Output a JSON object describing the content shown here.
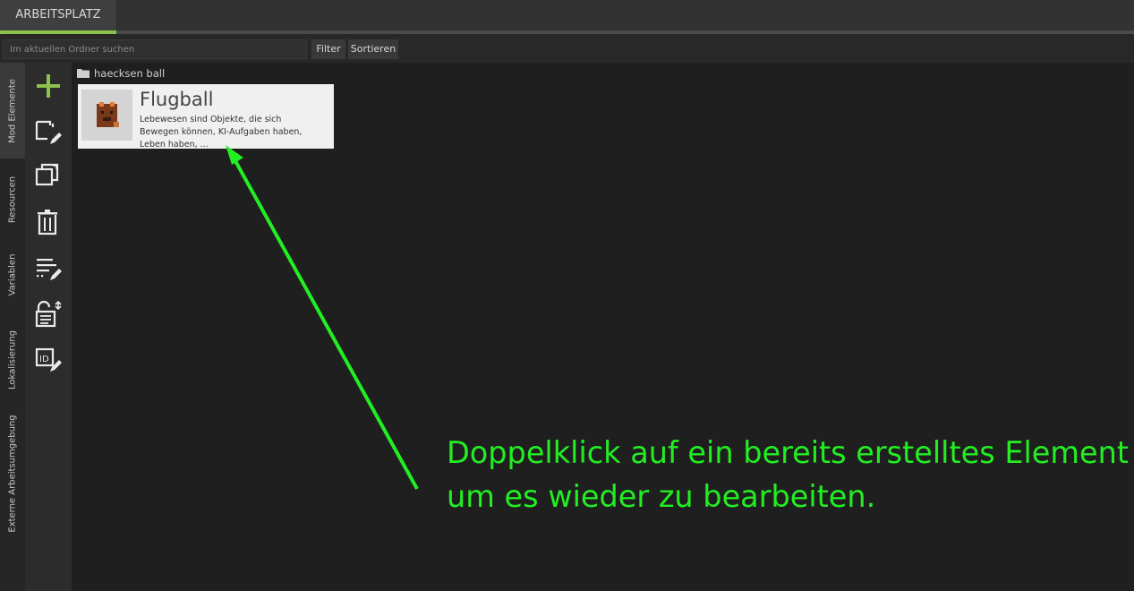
{
  "header": {
    "workspace_tab": "ARBEITSPLATZ"
  },
  "toolbar": {
    "search_placeholder": "Im aktuellen Ordner suchen",
    "filter_label": "Filter",
    "sort_label": "Sortieren"
  },
  "side_tabs": [
    "Mod Elemente",
    "Resourcen",
    "Variablen",
    "Lokalisierung",
    "Externe Arbeitsumgebung"
  ],
  "tool_icons": [
    "add-icon",
    "edit-icon",
    "duplicate-icon",
    "delete-icon",
    "properties-icon",
    "lock-icon",
    "id-icon"
  ],
  "breadcrumb": {
    "folder": "haecksen ball"
  },
  "element_card": {
    "title": "Flugball",
    "description": "Lebewesen sind Objekte, die sich Bewegen können, KI-Aufgaben haben, Leben haben, ..."
  },
  "annotation": {
    "line1": "Doppelklick auf ein bereits erstelltes Element",
    "line2": "um es wieder zu bearbeiten.",
    "color": "#22ee22"
  },
  "colors": {
    "accent": "#8bc34a",
    "background": "#202020"
  }
}
